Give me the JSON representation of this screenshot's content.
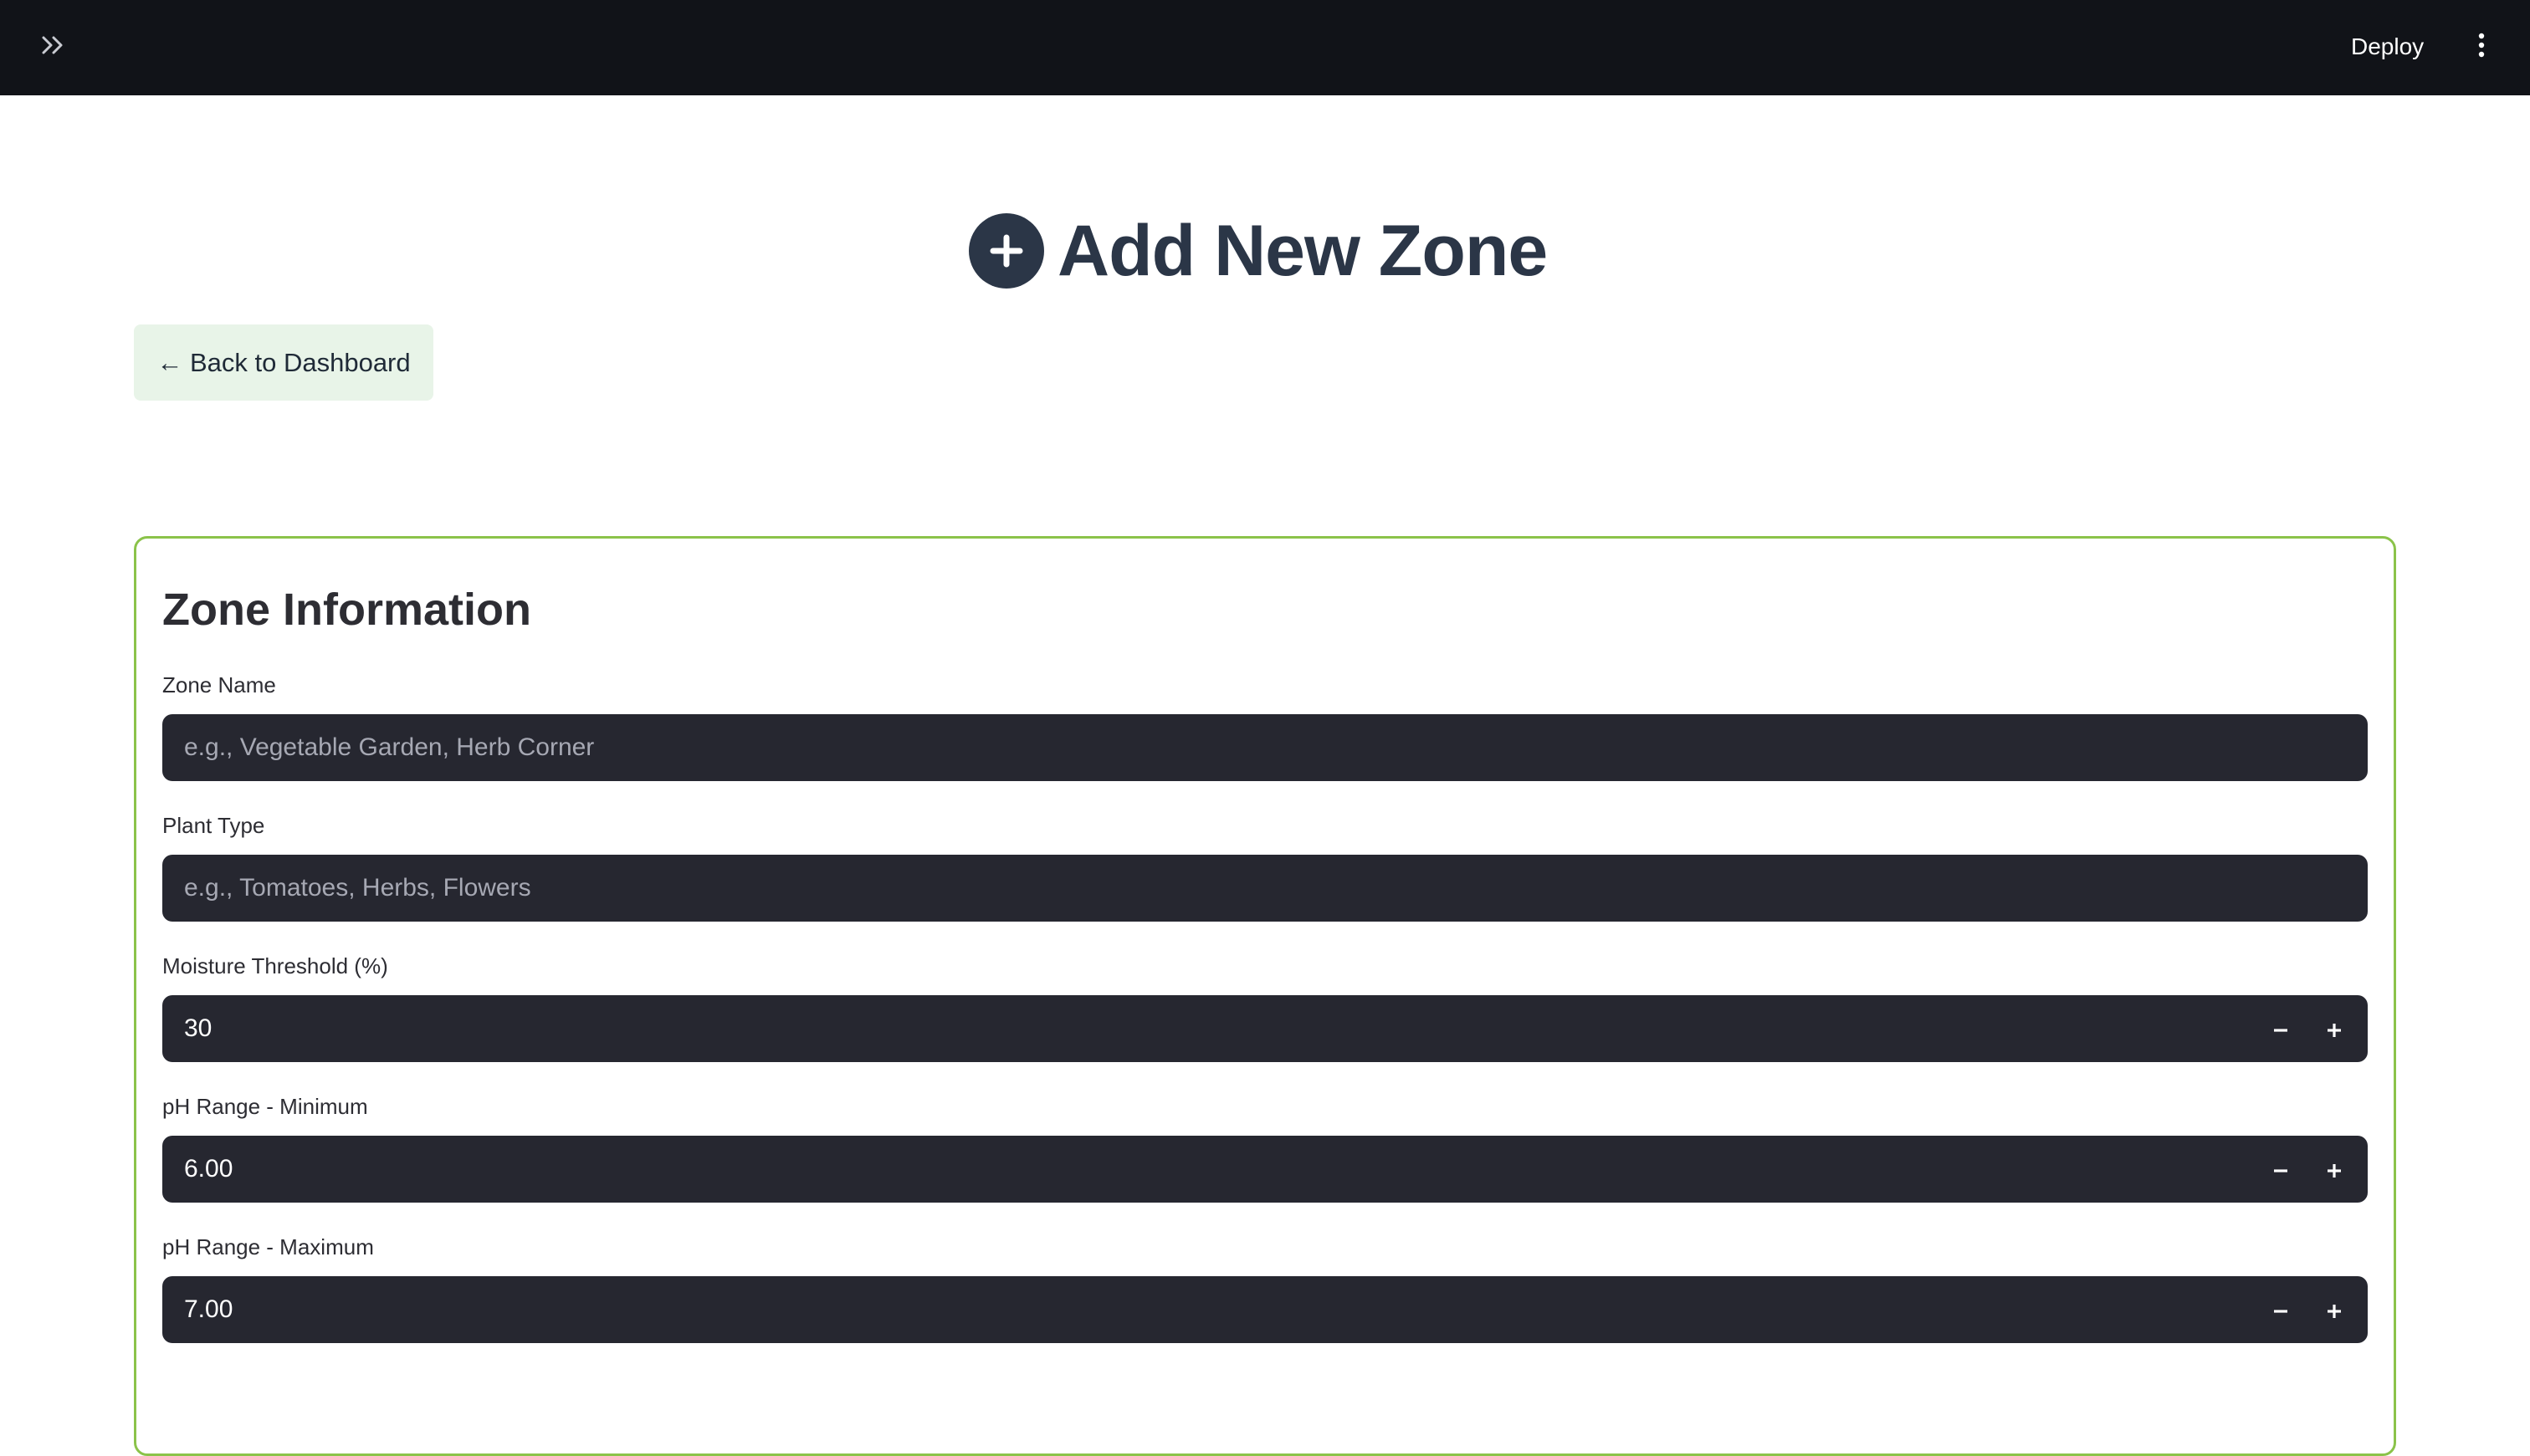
{
  "header": {
    "deploy_label": "Deploy"
  },
  "page": {
    "title": "Add New Zone",
    "back_label": "← Back to Dashboard"
  },
  "form": {
    "section_title": "Zone Information",
    "zone_name": {
      "label": "Zone Name",
      "placeholder": "e.g., Vegetable Garden, Herb Corner",
      "value": ""
    },
    "plant_type": {
      "label": "Plant Type",
      "placeholder": "e.g., Tomatoes, Herbs, Flowers",
      "value": ""
    },
    "moisture_threshold": {
      "label": "Moisture Threshold (%)",
      "value": "30"
    },
    "ph_min": {
      "label": "pH Range - Minimum",
      "value": "6.00"
    },
    "ph_max": {
      "label": "pH Range - Maximum",
      "value": "7.00"
    }
  },
  "colors": {
    "topbar_bg": "#111318",
    "title_color": "#2b3647",
    "card_border": "#8bc34a",
    "back_button_bg": "#e8f4e8",
    "input_bg": "#262730"
  },
  "icons": {
    "sidebar_toggle": "double-chevron-right-icon",
    "menu": "vertical-dots-icon",
    "title": "plus-circle-icon",
    "decrement": "minus-icon",
    "increment": "plus-icon"
  }
}
